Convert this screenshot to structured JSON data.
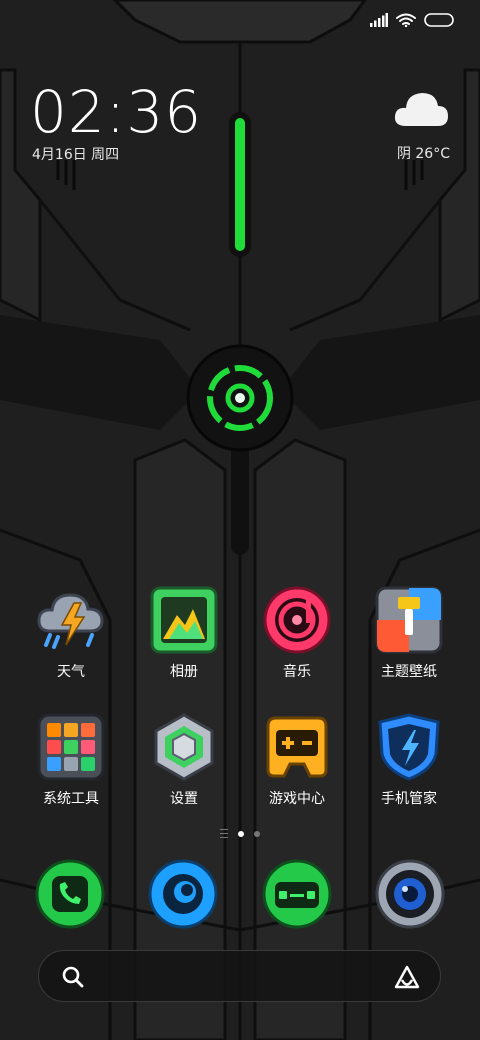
{
  "status_bar": {
    "signal_icon": "signal-bars-icon",
    "wifi_icon": "wifi-icon",
    "battery_icon": "battery-icon"
  },
  "clock": {
    "time": "02:36",
    "date": "4月16日 周四"
  },
  "weather": {
    "icon": "cloud-icon",
    "text": "阴  26°C"
  },
  "apps": [
    {
      "label": "天气",
      "icon": "weather-storm-icon"
    },
    {
      "label": "相册",
      "icon": "gallery-icon"
    },
    {
      "label": "音乐",
      "icon": "music-icon"
    },
    {
      "label": "主题壁纸",
      "icon": "theme-brush-icon"
    },
    {
      "label": "系统工具",
      "icon": "tools-folder-icon"
    },
    {
      "label": "设置",
      "icon": "settings-hexagon-icon"
    },
    {
      "label": "游戏中心",
      "icon": "gamepad-icon"
    },
    {
      "label": "手机管家",
      "icon": "shield-bolt-icon"
    }
  ],
  "page_indicator": {
    "pages": 2,
    "current": 1
  },
  "dock": [
    {
      "icon": "phone-icon"
    },
    {
      "icon": "browser-icon"
    },
    {
      "icon": "messages-icon"
    },
    {
      "icon": "camera-icon"
    }
  ],
  "search": {
    "search_icon": "search-icon",
    "assistant_icon": "assistant-a-icon"
  },
  "colors": {
    "accent_green": "#1fdc3b",
    "background": "#1e1e1e"
  }
}
